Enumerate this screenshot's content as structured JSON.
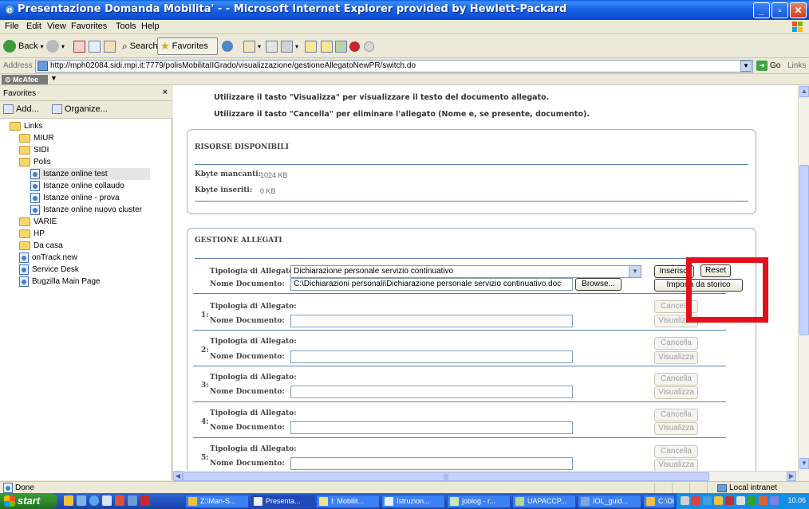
{
  "window": {
    "title": "Presentazione Domanda Mobilita' - - Microsoft Internet Explorer provided by Hewlett-Packard"
  },
  "menu": [
    "File",
    "Edit",
    "View",
    "Favorites",
    "Tools",
    "Help"
  ],
  "toolbar": {
    "back_label": "Back",
    "search_label": "Search",
    "favorites_label": "Favorites"
  },
  "address": {
    "label": "Address",
    "url": "http://mph02084.sidi.mpi.it:7779/polisMobilitaIIGrado/visualizzazione/gestioneAllegatoNewPR/switch.do",
    "go_label": "Go",
    "links_label": "Links"
  },
  "mcafee": {
    "label": "McAfee"
  },
  "favorites": {
    "title": "Favorites",
    "add_label": "Add...",
    "organize_label": "Organize...",
    "items": [
      {
        "label": "Links",
        "type": "folder"
      },
      {
        "label": "MIUR",
        "type": "folder"
      },
      {
        "label": "SIDI",
        "type": "folder"
      },
      {
        "label": "Polis",
        "type": "folder"
      },
      {
        "label": "Istanze online test",
        "type": "page"
      },
      {
        "label": "Istanze online collaudo",
        "type": "page"
      },
      {
        "label": "Istanze online - prova",
        "type": "page"
      },
      {
        "label": "Istanze online nuovo cluster",
        "type": "page"
      },
      {
        "label": "VARIE",
        "type": "folder"
      },
      {
        "label": "HP",
        "type": "folder"
      },
      {
        "label": "Da casa",
        "type": "folder"
      },
      {
        "label": "onTrack new",
        "type": "page"
      },
      {
        "label": "Service Desk",
        "type": "page"
      },
      {
        "label": "Bugzilla Main Page",
        "type": "page"
      }
    ]
  },
  "content": {
    "instructions": [
      "Utilizzare il tasto \"Visualizza\" per visualizzare il testo del documento allegato.",
      "Utilizzare il tasto \"Cancella\" per eliminare l'allegato (Nome e, se presente, documento)."
    ],
    "risorse": {
      "title": "RISORSE DISPONIBILI",
      "kbyte_mancanti_label": "Kbyte mancanti:",
      "kbyte_mancanti_value": "1024 KB",
      "kbyte_inseriti_label": "Kbyte inseriti:",
      "kbyte_inseriti_value": "0 KB"
    },
    "gestione": {
      "title": "GESTIONE ALLEGATI",
      "tipologia_label": "Tipologia di Allegato:",
      "nome_label": "Nome Documento:",
      "selected_tipologia": "Dichiarazione personale servizio continuativo",
      "nome_value": "C:\\Dichiarazioni personali\\Dichiarazione personale servizio continuativo.doc",
      "browse_label": "Browse...",
      "inserisci_label": "Inserisci",
      "reset_label": "Reset",
      "importa_label": "Importa da storico",
      "cancella_label": "Cancella",
      "visualizza_label": "Visualizza",
      "rows": [
        "1:",
        "2:",
        "3:",
        "4:",
        "5:"
      ]
    }
  },
  "status": {
    "done_label": "Done",
    "zone_label": "Local intranet"
  },
  "taskbar": {
    "start_label": "start",
    "tasks": [
      "Z:\\Man-S...",
      "Presenta...",
      "I: Mobilit...",
      "Istruzion...",
      "joblog - r...",
      "UAPACCP...",
      "IOL_guid...",
      "C:\\Dichia..."
    ],
    "clock": "10.06"
  },
  "colors": {
    "highlight_box": "#e3101a",
    "panel_border": "#9db0c9",
    "titlebar": "#0a4fd2"
  }
}
